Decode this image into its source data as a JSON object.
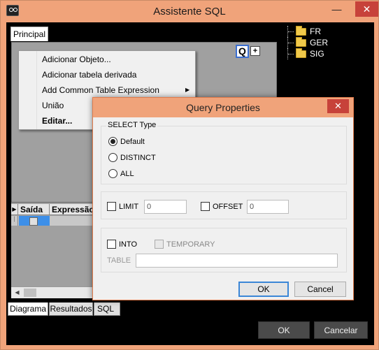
{
  "window": {
    "title": "Assistente SQL",
    "minimize": "—",
    "maximize": "☐",
    "close": "✕"
  },
  "top_tabs": [
    "Principal"
  ],
  "zoom": {
    "q": "Q",
    "plus": "+"
  },
  "context_menu": {
    "items": [
      {
        "label": "Adicionar Objeto..."
      },
      {
        "label": "Adicionar tabela derivada"
      },
      {
        "label": "Add Common Table Expression",
        "submenu": true
      },
      {
        "label": "União"
      },
      {
        "label": "Editar...",
        "bold": true
      }
    ]
  },
  "grid": {
    "columns": [
      "Saída",
      "Expressão"
    ]
  },
  "bottom_tabs": [
    "Diagrama",
    "Resultados",
    "SQL"
  ],
  "tree": {
    "items": [
      "FR",
      "GER",
      "SIG"
    ]
  },
  "buttons": {
    "ok": "OK",
    "cancel": "Cancelar"
  },
  "dialog": {
    "title": "Query Properties",
    "close": "✕",
    "select_type": {
      "legend": "SELECT Type",
      "options": [
        "Default",
        "DISTINCT",
        "ALL"
      ],
      "selected": "Default"
    },
    "limit": {
      "label": "LIMIT",
      "value": "0"
    },
    "offset": {
      "label": "OFFSET",
      "value": "0"
    },
    "into": {
      "label": "INTO"
    },
    "temporary": {
      "label": "TEMPORARY"
    },
    "table": {
      "label": "TABLE",
      "value": ""
    },
    "ok": "OK",
    "cancel": "Cancel"
  }
}
